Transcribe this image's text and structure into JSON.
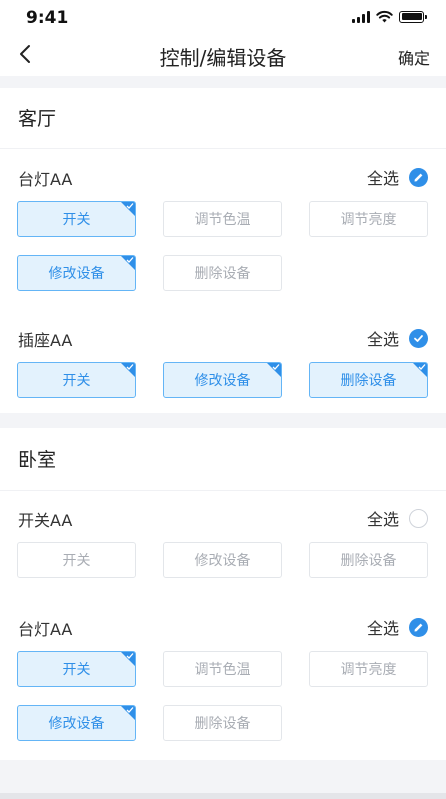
{
  "status_bar": {
    "time": "9:41"
  },
  "nav": {
    "title": "控制/编辑设备",
    "confirm": "确定"
  },
  "rooms": [
    {
      "name": "客厅",
      "devices": [
        {
          "name": "台灯AA",
          "select_all_label": "全选",
          "select_all_state": "partial",
          "buttons": [
            {
              "label": "开关",
              "selected": true
            },
            {
              "label": "调节色温",
              "selected": false
            },
            {
              "label": "调节亮度",
              "selected": false
            },
            {
              "label": "修改设备",
              "selected": true
            },
            {
              "label": "删除设备",
              "selected": false
            }
          ]
        },
        {
          "name": "插座AA",
          "select_all_label": "全选",
          "select_all_state": "all",
          "buttons": [
            {
              "label": "开关",
              "selected": true
            },
            {
              "label": "修改设备",
              "selected": true
            },
            {
              "label": "删除设备",
              "selected": true
            }
          ]
        }
      ]
    },
    {
      "name": "卧室",
      "devices": [
        {
          "name": "开关AA",
          "select_all_label": "全选",
          "select_all_state": "none",
          "buttons": [
            {
              "label": "开关",
              "selected": false
            },
            {
              "label": "修改设备",
              "selected": false
            },
            {
              "label": "删除设备",
              "selected": false
            }
          ]
        },
        {
          "name": "台灯AA",
          "select_all_label": "全选",
          "select_all_state": "partial",
          "buttons": [
            {
              "label": "开关",
              "selected": true
            },
            {
              "label": "调节色温",
              "selected": false
            },
            {
              "label": "调节亮度",
              "selected": false
            },
            {
              "label": "修改设备",
              "selected": true
            },
            {
              "label": "删除设备",
              "selected": false
            }
          ]
        }
      ]
    }
  ],
  "colors": {
    "accent": "#2f8fe8",
    "selected_bg": "#e3f2fd",
    "page_bg": "#f3f4f7"
  },
  "icons": {
    "back": "chevron-left-icon",
    "partial": "pencil-icon",
    "all": "checkmark-icon",
    "none": "empty-circle-icon"
  }
}
